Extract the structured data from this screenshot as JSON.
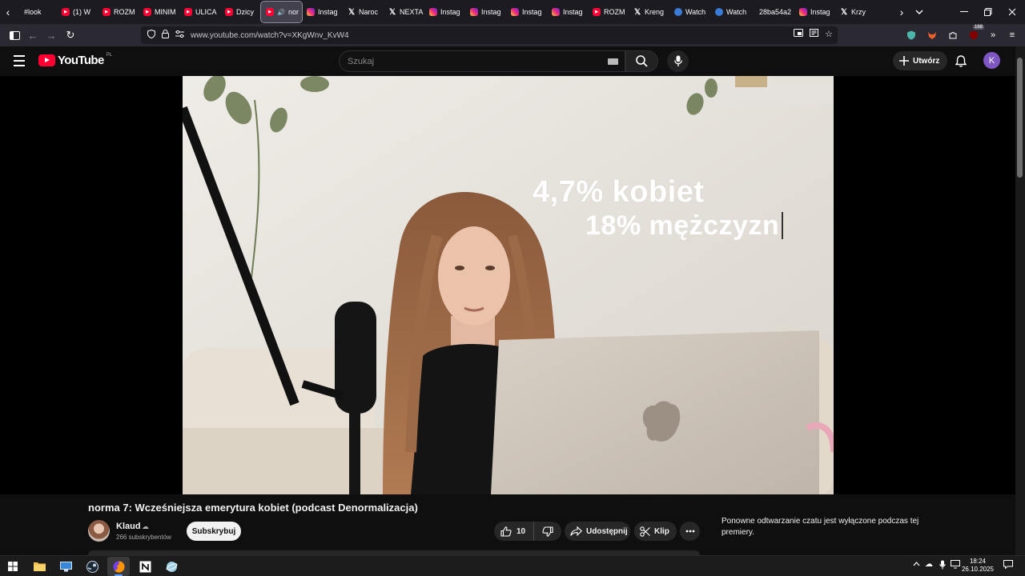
{
  "browser": {
    "tabs": [
      {
        "label": "#look",
        "favicon": "none",
        "active": false
      },
      {
        "label": "(1) W",
        "favicon": "youtube",
        "active": false
      },
      {
        "label": "ROZM",
        "favicon": "youtube",
        "active": false
      },
      {
        "label": "MINIM",
        "favicon": "youtube",
        "active": false
      },
      {
        "label": "ULICA",
        "favicon": "youtube",
        "active": false
      },
      {
        "label": "Dzicy",
        "favicon": "youtube",
        "active": false
      },
      {
        "label": "nor",
        "favicon": "youtube",
        "active": true
      },
      {
        "label": "Instag",
        "favicon": "instagram",
        "active": false
      },
      {
        "label": "Naroc",
        "favicon": "x",
        "active": false
      },
      {
        "label": "NEXTA",
        "favicon": "x",
        "active": false
      },
      {
        "label": "Instag",
        "favicon": "instagram",
        "active": false
      },
      {
        "label": "Instag",
        "favicon": "instagram",
        "active": false
      },
      {
        "label": "Instag",
        "favicon": "instagram",
        "active": false
      },
      {
        "label": "Instag",
        "favicon": "instagram",
        "active": false
      },
      {
        "label": "ROZM",
        "favicon": "youtube",
        "active": false
      },
      {
        "label": "Kreng",
        "favicon": "x",
        "active": false
      },
      {
        "label": "Watch",
        "favicon": "copilot",
        "active": false
      },
      {
        "label": "Watch",
        "favicon": "copilot",
        "active": false
      },
      {
        "label": "28ba54a2",
        "favicon": "none",
        "active": false
      },
      {
        "label": "Instag",
        "favicon": "instagram",
        "active": false
      },
      {
        "label": "Krzy",
        "favicon": "x",
        "active": false
      }
    ],
    "url": "www.youtube.com/watch?v=XKgWnv_KvW4",
    "extension_badge": "168"
  },
  "youtube": {
    "logo_text": "YouTube",
    "country_code": "PL",
    "search_placeholder": "Szukaj",
    "create_label": "Utwórz",
    "avatar_letter": "K"
  },
  "video": {
    "overlay_line1": "4,7% kobiet",
    "overlay_line2": "18% mężczyzn",
    "title": "norma 7: Wcześniejsza emerytura kobiet (podcast Denormalizacja)",
    "channel_name": "Klaud",
    "subscribers": "266 subskrybentów",
    "subscribe_label": "Subskrybuj",
    "likes": "10",
    "share_label": "Udostępnij",
    "clip_label": "Klip",
    "chat_disabled_note": "Ponowne odtwarzanie czatu jest wyłączone podczas tej premiery."
  },
  "taskbar": {
    "time": "18:24",
    "date": "26.10.2025"
  },
  "colors": {
    "youtube_red": "#ff0033",
    "avatar_purple": "#7e57c2",
    "browser_dark": "#1c1b22"
  }
}
